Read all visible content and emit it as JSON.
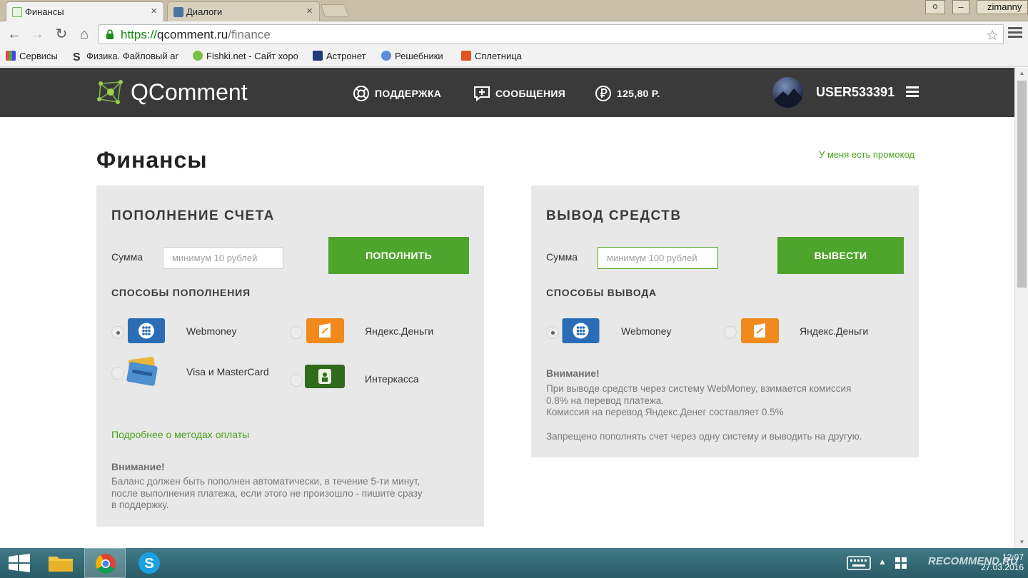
{
  "browser": {
    "tabs": [
      {
        "title": "Финансы",
        "active": true
      },
      {
        "title": "Диалоги",
        "active": false
      }
    ],
    "profile_name": "zimanny",
    "url": {
      "scheme": "https://",
      "host": "qcomment.ru",
      "path": "/finance"
    },
    "bookmarks": [
      {
        "label": "Сервисы",
        "icon": "apps-grid-icon"
      },
      {
        "label": "Физика. Файловый ar",
        "icon": "s-icon"
      },
      {
        "label": "Fishki.net - Сайт хоро",
        "icon": "fishki-icon"
      },
      {
        "label": "Астронет",
        "icon": "astronet-icon"
      },
      {
        "label": "Решебники",
        "icon": "reshebniki-icon"
      },
      {
        "label": "Сплетница",
        "icon": "spletnitsa-icon"
      }
    ]
  },
  "site": {
    "logo_text": "QComment",
    "nav": {
      "support": "ПОДДЕРЖКА",
      "messages": "СООБЩЕНИЯ",
      "balance": "125,80 Р."
    },
    "username": "USER533391"
  },
  "page": {
    "title": "Финансы",
    "promo_link": "У меня есть промокод",
    "deposit": {
      "title": "ПОПОЛНЕНИЕ СЧЕТА",
      "sum_label": "Сумма",
      "sum_placeholder": "минимум 10 рублей",
      "button": "ПОПОЛНИТЬ",
      "methods_title": "СПОСОБЫ ПОПОЛНЕНИЯ",
      "methods": [
        {
          "label": "Webmoney",
          "checked": true
        },
        {
          "label": "Яндекс.Деньги",
          "checked": false
        },
        {
          "label": "Visa и MasterCard",
          "checked": false
        },
        {
          "label": "Интеркасса",
          "checked": false
        }
      ],
      "more_link": "Подробнее о методах оплаты",
      "note_title": "Внимание!",
      "note_lines": [
        "Баланс должен быть пополнен автоматически, в течение 5-ти минут,",
        "после выполнения платежа, если этого не произошло - пишите сразу",
        "в поддержку."
      ]
    },
    "withdraw": {
      "title": "ВЫВОД СРЕДСТВ",
      "sum_label": "Сумма",
      "sum_placeholder": "минимум 100 рублей",
      "button": "ВЫВЕСТИ",
      "methods_title": "СПОСОБЫ ВЫВОДА",
      "methods": [
        {
          "label": "Webmoney",
          "checked": true
        },
        {
          "label": "Яндекс.Деньги",
          "checked": false
        }
      ],
      "note_title": "Внимание!",
      "note_lines": [
        "При выводе средств через систему WebMoney, взимается комиссия",
        "0.8% на перевод платежа.",
        "Комиссия на перевод Яндекс.Денег составляет 0.5%"
      ],
      "note_extra": "Запрещено пополнять счет через одну систему и выводить на другую."
    }
  },
  "taskbar": {
    "time": "12:07",
    "date": "27.03.2016",
    "watermark": "RECOMMEND.RU"
  },
  "colors": {
    "accent_green": "#4ea52b",
    "header_bg": "#3a3a3a",
    "panel_bg": "#e8e8e8",
    "webmoney_blue": "#2a6db5",
    "yandex_orange": "#f08a1c",
    "interkassa_green": "#2f6b1d"
  }
}
